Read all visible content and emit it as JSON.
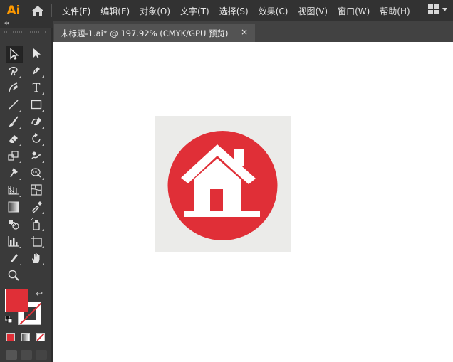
{
  "app": {
    "logo_text": "Ai",
    "brand_color": "#ff9a00"
  },
  "menu": {
    "items": [
      "文件(F)",
      "编辑(E)",
      "对象(O)",
      "文字(T)",
      "选择(S)",
      "效果(C)",
      "视图(V)",
      "窗口(W)",
      "帮助(H)"
    ]
  },
  "document_tab": {
    "label": "未标题-1.ai* @ 197.92% (CMYK/GPU 预览)",
    "close": "×"
  },
  "toolbar": {
    "collapse_glyph": "◂◂",
    "tools": [
      {
        "name": "selection-tool",
        "icon": "selection-arrow-icon"
      },
      {
        "name": "direct-selection-tool",
        "icon": "direct-selection-icon"
      },
      {
        "name": "magic-wand-tool",
        "icon": "magic-wand-icon"
      },
      {
        "name": "pen-tool",
        "icon": "pen-icon"
      },
      {
        "name": "curvature-tool",
        "icon": "curvature-icon"
      },
      {
        "name": "type-tool",
        "icon": "type-icon",
        "glyph": "T"
      },
      {
        "name": "line-tool",
        "icon": "line-icon"
      },
      {
        "name": "rectangle-tool",
        "icon": "rectangle-icon"
      },
      {
        "name": "paintbrush-tool",
        "icon": "paintbrush-icon"
      },
      {
        "name": "shaper-tool",
        "icon": "shaper-icon"
      },
      {
        "name": "eraser-tool",
        "icon": "eraser-icon"
      },
      {
        "name": "rotate-tool",
        "icon": "rotate-icon"
      },
      {
        "name": "scale-tool",
        "icon": "scale-icon"
      },
      {
        "name": "warp-tool",
        "icon": "warp-icon"
      },
      {
        "name": "puppet-warp-tool",
        "icon": "puppet-warp-icon"
      },
      {
        "name": "free-transform-tool",
        "icon": "free-transform-icon"
      },
      {
        "name": "perspective-grid-tool",
        "icon": "perspective-grid-icon"
      },
      {
        "name": "mesh-tool",
        "icon": "mesh-icon"
      },
      {
        "name": "gradient-tool",
        "icon": "gradient-icon"
      },
      {
        "name": "eyedropper-tool",
        "icon": "eyedropper-icon"
      },
      {
        "name": "blend-tool",
        "icon": "blend-icon"
      },
      {
        "name": "symbol-sprayer-tool",
        "icon": "symbol-sprayer-icon"
      },
      {
        "name": "column-graph-tool",
        "icon": "column-graph-icon"
      },
      {
        "name": "artboard-tool",
        "icon": "artboard-icon"
      },
      {
        "name": "slice-tool",
        "icon": "slice-icon"
      },
      {
        "name": "hand-tool",
        "icon": "hand-icon"
      },
      {
        "name": "zoom-tool",
        "icon": "zoom-icon"
      }
    ],
    "fill_color": "#e02f37",
    "stroke": "none"
  },
  "canvas": {
    "artboard_bg": "#ebebe9",
    "logo": {
      "circle_color": "#e02f37",
      "house_color": "#ffffff"
    }
  }
}
